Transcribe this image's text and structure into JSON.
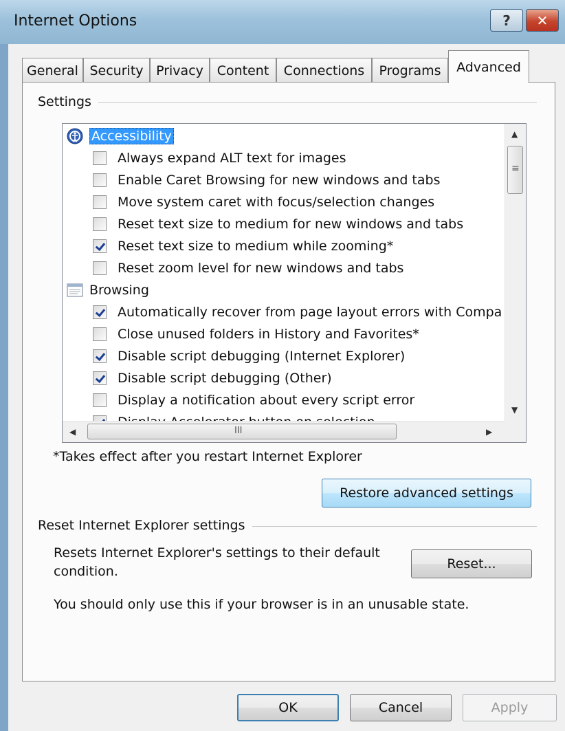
{
  "window": {
    "title": "Internet Options"
  },
  "tabs": [
    {
      "label": "General"
    },
    {
      "label": "Security"
    },
    {
      "label": "Privacy"
    },
    {
      "label": "Content"
    },
    {
      "label": "Connections"
    },
    {
      "label": "Programs"
    },
    {
      "label": "Advanced"
    }
  ],
  "active_tab": "Advanced",
  "settings": {
    "group_label": "Settings",
    "tree": [
      {
        "type": "category",
        "label": "Accessibility",
        "icon": "accessibility-icon",
        "selected": true
      },
      {
        "type": "checkbox",
        "label": "Always expand ALT text for images",
        "checked": false
      },
      {
        "type": "checkbox",
        "label": "Enable Caret Browsing for new windows and tabs",
        "checked": false
      },
      {
        "type": "checkbox",
        "label": "Move system caret with focus/selection changes",
        "checked": false
      },
      {
        "type": "checkbox",
        "label": "Reset text size to medium for new windows and tabs",
        "checked": false
      },
      {
        "type": "checkbox",
        "label": "Reset text size to medium while zooming*",
        "checked": true
      },
      {
        "type": "checkbox",
        "label": "Reset zoom level for new windows and tabs",
        "checked": false
      },
      {
        "type": "category",
        "label": "Browsing",
        "icon": "browsing-icon",
        "selected": false
      },
      {
        "type": "checkbox",
        "label": "Automatically recover from page layout errors with Compa",
        "checked": true
      },
      {
        "type": "checkbox",
        "label": "Close unused folders in History and Favorites*",
        "checked": false
      },
      {
        "type": "checkbox",
        "label": "Disable script debugging (Internet Explorer)",
        "checked": true
      },
      {
        "type": "checkbox",
        "label": "Disable script debugging (Other)",
        "checked": true
      },
      {
        "type": "checkbox",
        "label": "Display a notification about every script error",
        "checked": false
      },
      {
        "type": "checkbox",
        "label": "Display Accelerator button on selection",
        "checked": true
      }
    ],
    "note": "*Takes effect after you restart Internet Explorer",
    "restore_label": "Restore advanced settings"
  },
  "reset": {
    "group_label": "Reset Internet Explorer settings",
    "description_line1": "Resets Internet Explorer's settings to their default",
    "description_line2": "condition.",
    "button_label": "Reset...",
    "warning": "You should only use this if your browser is in an unusable state."
  },
  "footer": {
    "ok_label": "OK",
    "cancel_label": "Cancel",
    "apply_label": "Apply"
  },
  "icons": {
    "help": "?",
    "close": "✕",
    "scroll_up": "▲",
    "scroll_down": "▼",
    "scroll_left": "◀",
    "scroll_right": "▶",
    "grip_v": "≡",
    "grip_h": "III"
  },
  "colors": {
    "selection": "#3399ff",
    "check": "#1c3f94",
    "close_button": "#c5452c"
  }
}
